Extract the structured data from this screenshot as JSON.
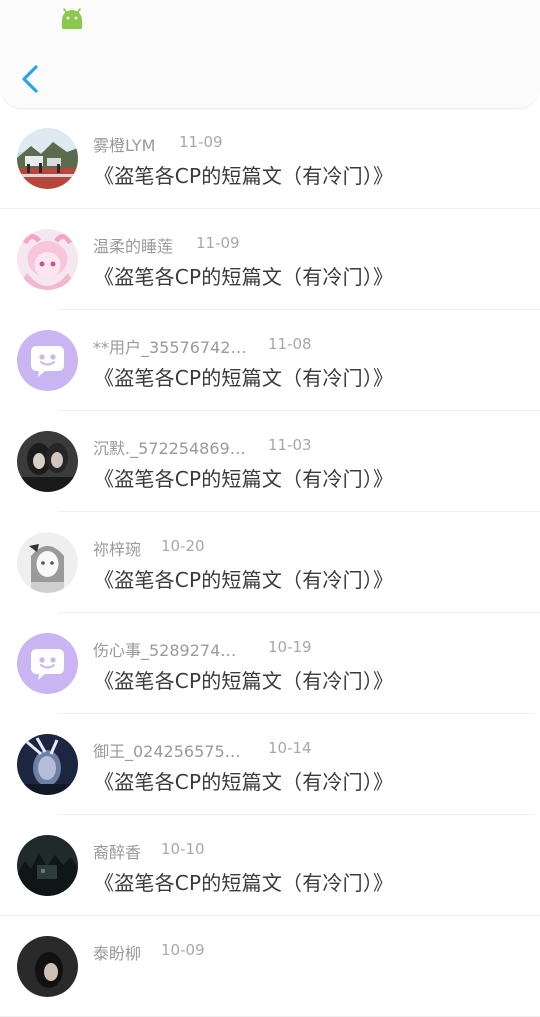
{
  "header": {
    "back_icon": "chevron-left-icon",
    "status_icon": "android-icon"
  },
  "colors": {
    "accent": "#2aa3ef",
    "android": "#8cc84b",
    "avatar_default": "#c9b5f2"
  },
  "rows": [
    {
      "username": "雾橙LYM",
      "date": "11-09",
      "title": "《盗笔各CP的短篇文（有冷门）》",
      "avatar": "photo-landscape"
    },
    {
      "username": "温柔的睡莲",
      "date": "11-09",
      "title": "《盗笔各CP的短篇文（有冷门）》",
      "avatar": "photo-anime-pink"
    },
    {
      "username": "**用户_35576742…",
      "date": "11-08",
      "title": "《盗笔各CP的短篇文（有冷门）》",
      "avatar": "default-chat"
    },
    {
      "username": "沉默._572254869…",
      "date": "11-03",
      "title": "《盗笔各CP的短篇文（有冷门）》",
      "avatar": "photo-dark-figures"
    },
    {
      "username": "祢梓琬",
      "date": "10-20",
      "title": "《盗笔各CP的短篇文（有冷门）》",
      "avatar": "photo-sketch-girl"
    },
    {
      "username": "伤心事_5289274…",
      "date": "10-19",
      "title": "《盗笔各CP的短篇文（有冷门）》",
      "avatar": "default-chat"
    },
    {
      "username": "御王_024256575…",
      "date": "10-14",
      "title": "《盗笔各CP的短篇文（有冷门）》",
      "avatar": "photo-dark-blue"
    },
    {
      "username": "裔醉香",
      "date": "10-10",
      "title": "《盗笔各CP的短篇文（有冷门）》",
      "avatar": "photo-dark-forest"
    },
    {
      "username": "泰盼柳",
      "date": "10-09",
      "title": "",
      "avatar": "photo-dark-partial"
    }
  ]
}
